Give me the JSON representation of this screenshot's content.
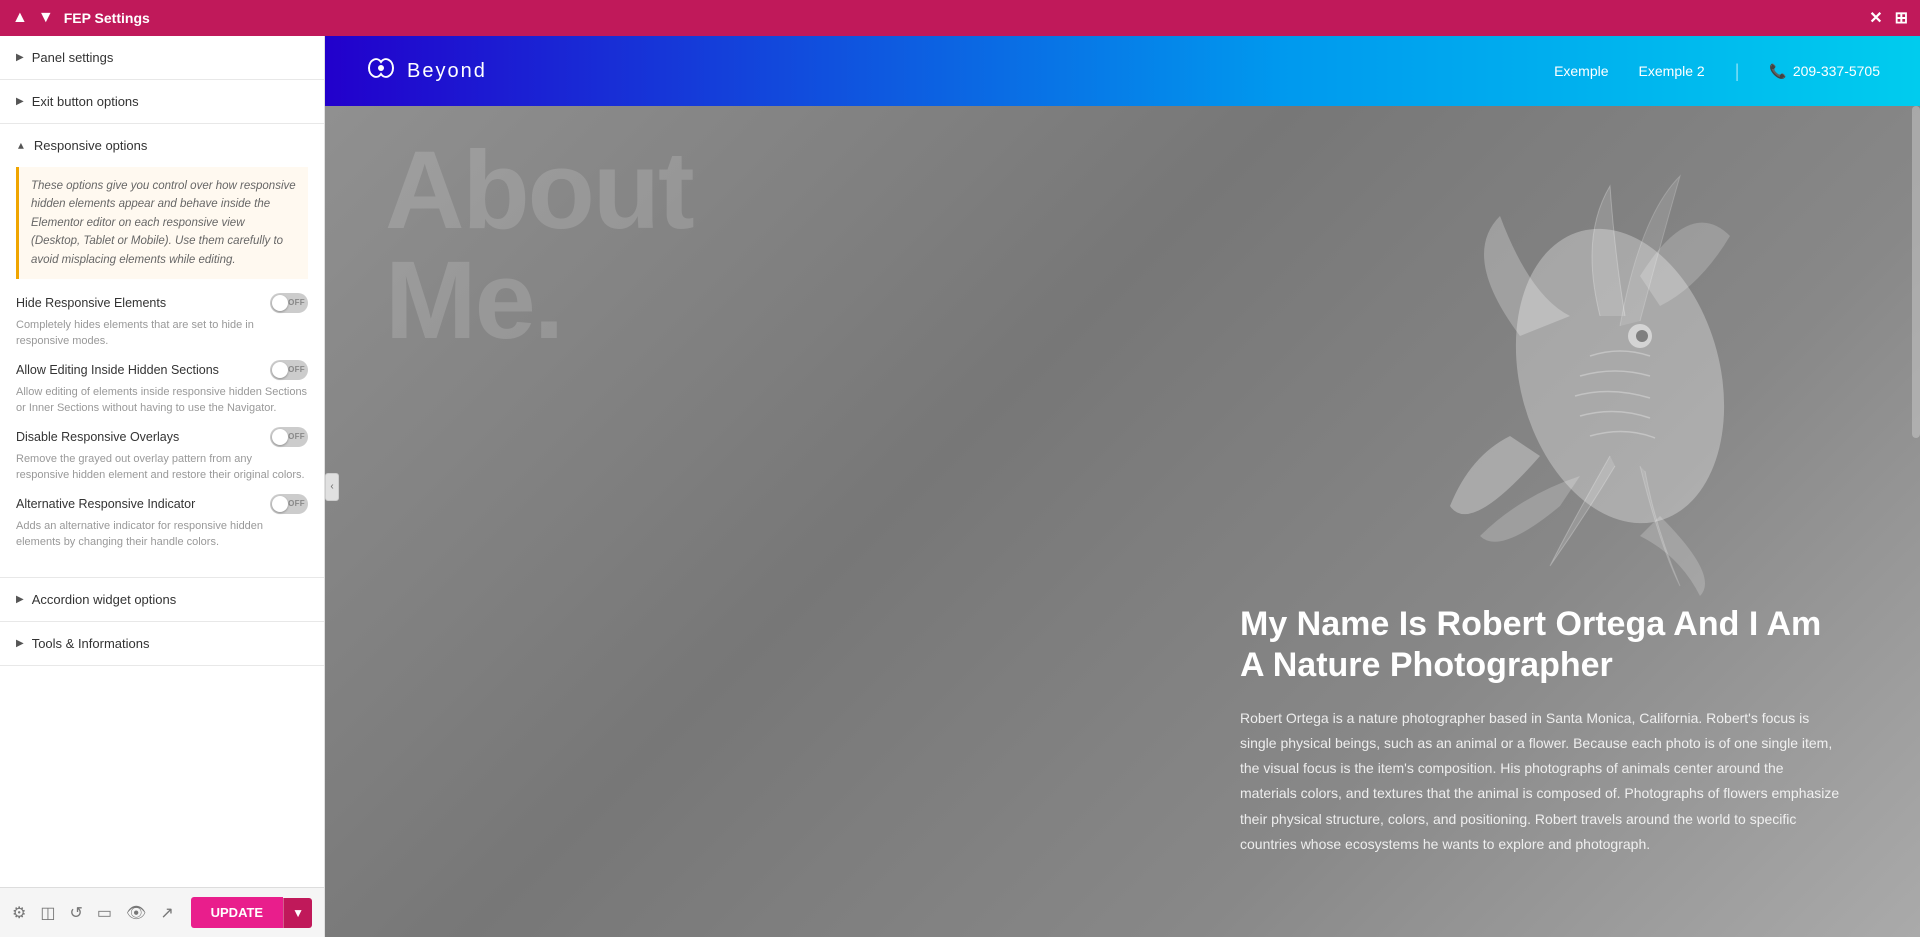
{
  "topbar": {
    "title": "FEP Settings",
    "up_icon": "▲",
    "down_icon": "▼",
    "close_icon": "✕",
    "grid_icon": "⊞"
  },
  "sidebar": {
    "sections": [
      {
        "id": "panel-settings",
        "label": "Panel settings",
        "expanded": false,
        "arrow": "▼"
      },
      {
        "id": "exit-button-options",
        "label": "Exit button options",
        "expanded": false,
        "arrow": "▶"
      },
      {
        "id": "responsive-options",
        "label": "Responsive options",
        "expanded": true,
        "arrow": "▼"
      },
      {
        "id": "accordion-widget-options",
        "label": "Accordion widget options",
        "expanded": false,
        "arrow": "▶"
      },
      {
        "id": "tools-informations",
        "label": "Tools & Informations",
        "expanded": false,
        "arrow": "▶"
      }
    ],
    "responsive_info": "These options give you control over how responsive hidden elements appear and behave inside the Elementor editor on each responsive view (Desktop, Tablet or Mobile). Use them carefully to avoid misplacing elements while editing.",
    "toggles": [
      {
        "label": "Hide Responsive Elements",
        "desc": "Completely hides elements that are set to hide in responsive modes."
      },
      {
        "label": "Allow Editing Inside Hidden Sections",
        "desc": "Allow editing of elements inside responsive hidden Sections or Inner Sections without having to use the Navigator."
      },
      {
        "label": "Disable Responsive Overlays",
        "desc": "Remove the grayed out overlay pattern from any responsive hidden element and restore their original colors."
      },
      {
        "label": "Alternative Responsive Indicator",
        "desc": "Adds an alternative indicator for responsive hidden elements by changing their handle colors."
      }
    ]
  },
  "bottom_toolbar": {
    "update_label": "UPDATE",
    "dropdown_icon": "▼"
  },
  "site_header": {
    "logo_text": "Beyond",
    "logo_icon": "❋",
    "nav_items": [
      "Exemple",
      "Exemple 2"
    ],
    "phone": "209-337-5705",
    "phone_icon": "📞"
  },
  "hero": {
    "big_text_line1": "About",
    "big_text_line2": "Me.",
    "title": "My Name Is Robert Ortega And I Am A Nature Photographer",
    "description": "Robert Ortega is a nature photographer based in Santa Monica, California. Robert's focus is single physical beings, such as an animal or a flower. Because each photo is of one single item, the visual focus is the item's composition. His photographs of animals center around the materials colors, and textures that the animal is composed of. Photographs of flowers emphasize their physical structure, colors, and positioning. Robert travels around the world to specific countries whose ecosystems he wants to explore and photograph."
  },
  "colors": {
    "topbar_bg": "#c0195a",
    "accent": "#e91e8c",
    "toggle_off": "#ccc",
    "border_info": "#f0a500"
  }
}
